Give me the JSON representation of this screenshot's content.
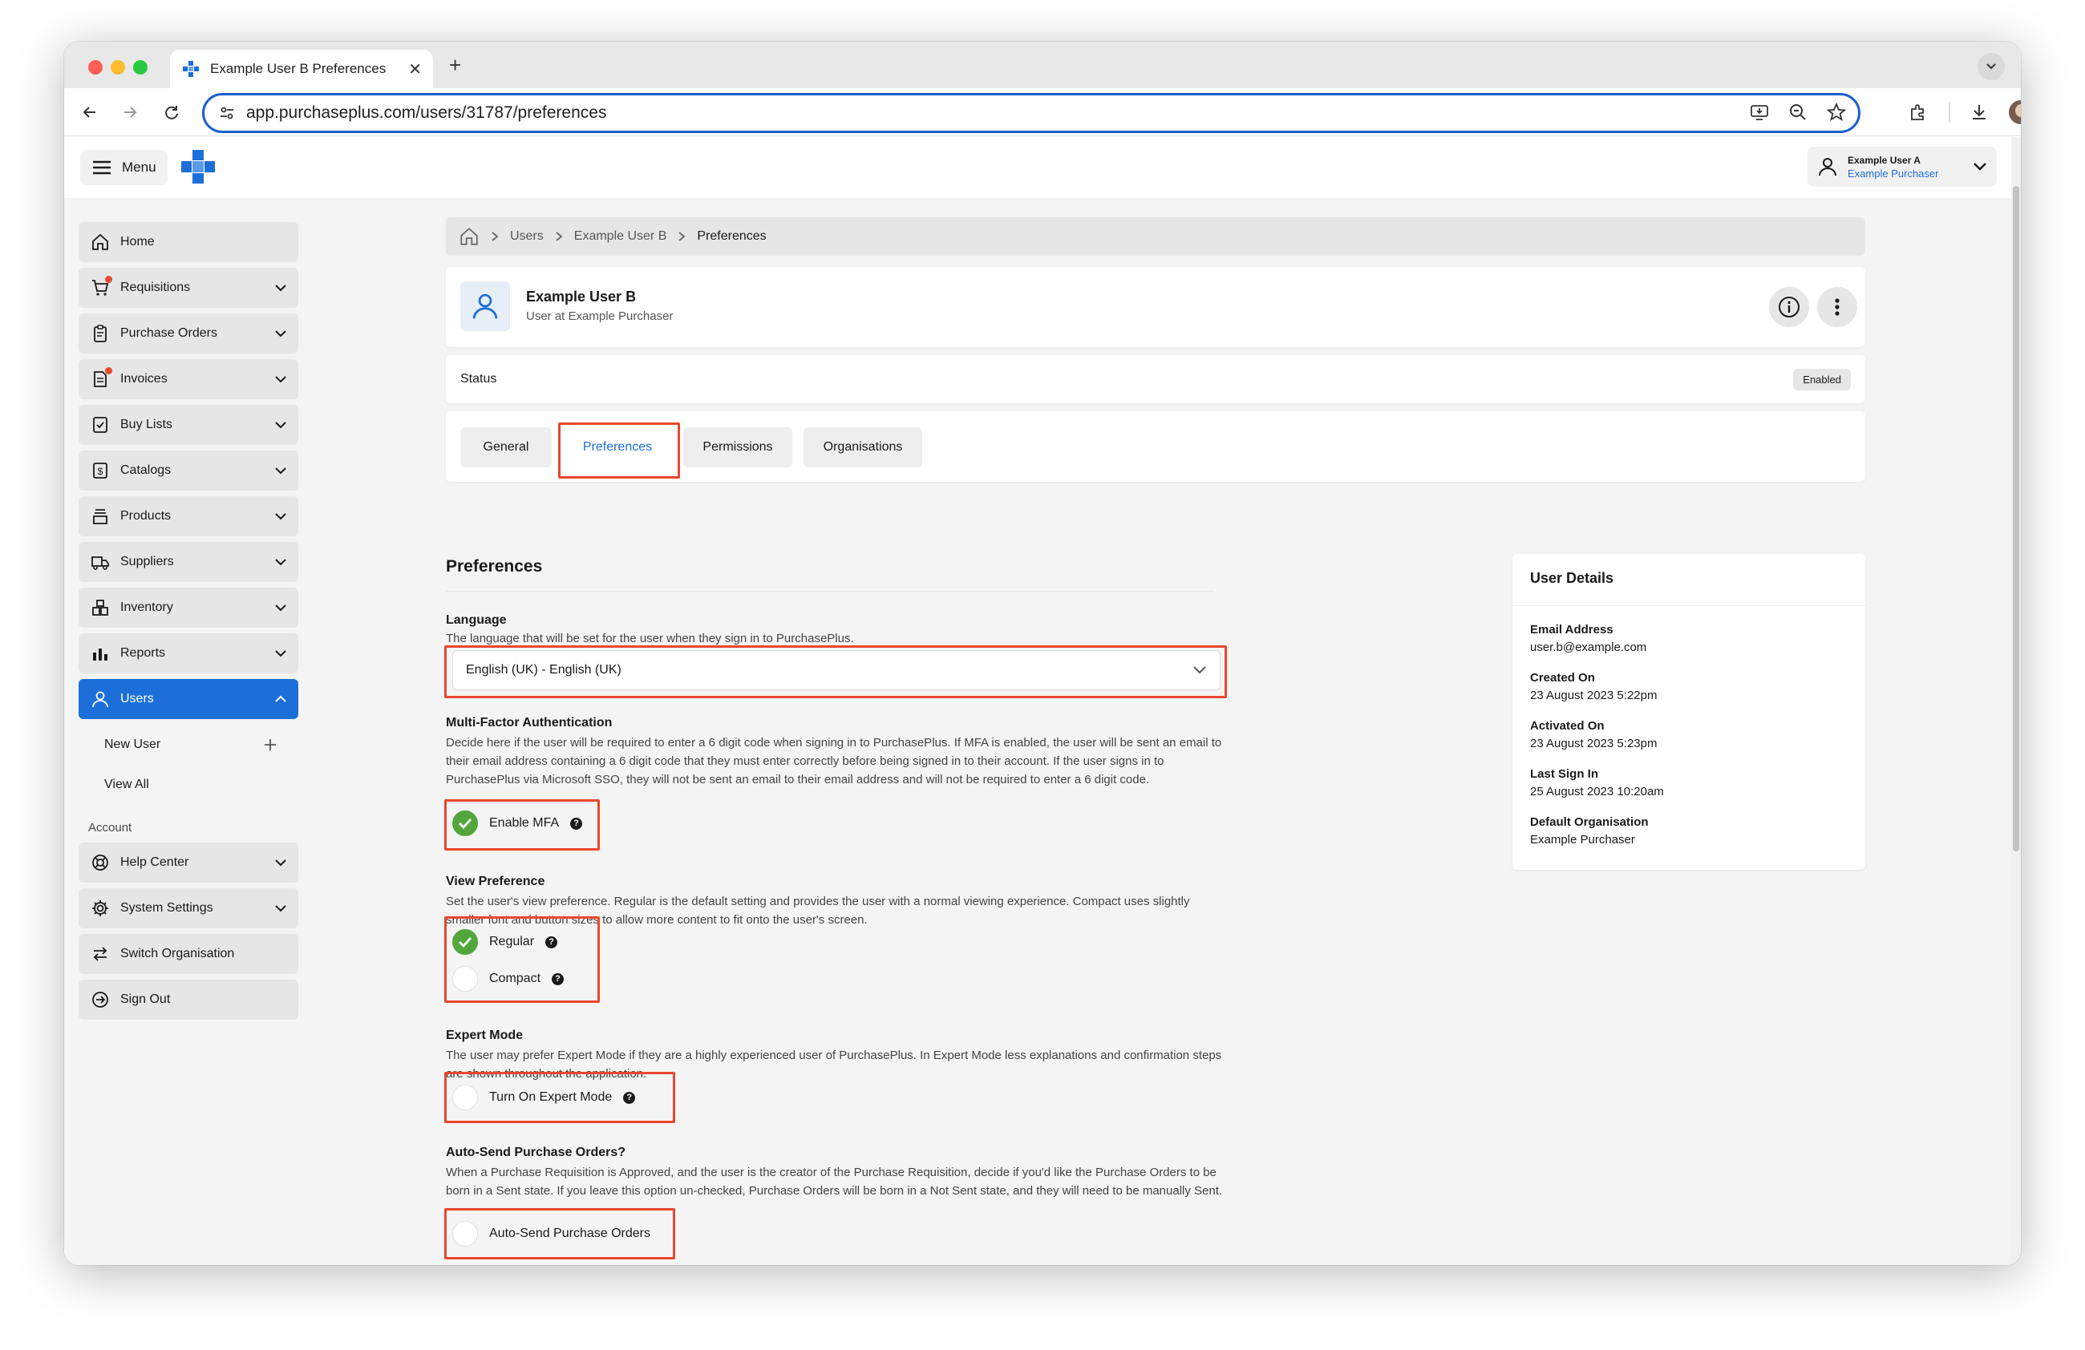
{
  "browser": {
    "tab_title": "Example User B Preferences",
    "url": "app.purchaseplus.com/users/31787/preferences"
  },
  "header": {
    "menu_label": "Menu",
    "user_name": "Example User A",
    "user_org": "Example Purchaser"
  },
  "sidebar": {
    "items": [
      {
        "label": "Home",
        "icon": "home-icon"
      },
      {
        "label": "Requisitions",
        "icon": "cart-icon"
      },
      {
        "label": "Purchase Orders",
        "icon": "clipboard-icon"
      },
      {
        "label": "Invoices",
        "icon": "invoice-icon"
      },
      {
        "label": "Buy Lists",
        "icon": "checklist-icon"
      },
      {
        "label": "Catalogs",
        "icon": "catalog-icon"
      },
      {
        "label": "Products",
        "icon": "products-icon"
      },
      {
        "label": "Suppliers",
        "icon": "truck-icon"
      },
      {
        "label": "Inventory",
        "icon": "inventory-icon"
      },
      {
        "label": "Reports",
        "icon": "chart-icon"
      },
      {
        "label": "Users",
        "icon": "user-icon"
      }
    ],
    "users_sub": [
      {
        "label": "New User"
      },
      {
        "label": "View All"
      }
    ],
    "account_heading": "Account",
    "account_items": [
      {
        "label": "Help Center",
        "icon": "lifebuoy-icon"
      },
      {
        "label": "System Settings",
        "icon": "gear-icon"
      },
      {
        "label": "Switch Organisation",
        "icon": "switch-icon"
      },
      {
        "label": "Sign Out",
        "icon": "sign-out-icon"
      }
    ]
  },
  "breadcrumb": {
    "items": [
      "Users",
      "Example User B",
      "Preferences"
    ]
  },
  "user_card": {
    "name": "Example User B",
    "subtitle": "User at Example Purchaser"
  },
  "status": {
    "label": "Status",
    "value": "Enabled"
  },
  "tabs": [
    {
      "label": "General"
    },
    {
      "label": "Preferences"
    },
    {
      "label": "Permissions"
    },
    {
      "label": "Organisations"
    }
  ],
  "preferences": {
    "title": "Preferences",
    "language": {
      "label": "Language",
      "description": "The language that will be set for the user when they sign in to PurchasePlus.",
      "value": "English (UK) - English (UK)"
    },
    "mfa": {
      "label": "Multi-Factor Authentication",
      "description": "Decide here if the user will be required to enter a 6 digit code when signing in to PurchasePlus. If MFA is enabled, the user will be sent an email to their email address containing a 6 digit code that they must enter correctly before being signed in to their account. If the user signs in to PurchasePlus via Microsoft SSO, they will not be sent an email to their email address and will not be required to enter a 6 digit code.",
      "option": "Enable MFA",
      "checked": true
    },
    "view": {
      "label": "View Preference",
      "description": "Set the user's view preference. Regular is the default setting and provides the user with a normal viewing experience. Compact uses slightly smaller font and button sizes to allow more content to fit onto the user's screen.",
      "option_regular": "Regular",
      "option_compact": "Compact",
      "selected": "Regular"
    },
    "expert": {
      "label": "Expert Mode",
      "description": "The user may prefer Expert Mode if they are a highly experienced user of PurchasePlus. In Expert Mode less explanations and confirmation steps are shown throughout the application.",
      "option": "Turn On Expert Mode",
      "checked": false
    },
    "autosend": {
      "label": "Auto-Send Purchase Orders?",
      "description": "When a Purchase Requisition is Approved, and the user is the creator of the Purchase Requisition, decide if you'd like the Purchase Orders to be born in a Sent state. If you leave this option un-checked, Purchase Orders will be born in a Not Sent state, and they will need to be manually Sent.",
      "option": "Auto-Send Purchase Orders",
      "checked": false
    }
  },
  "user_details": {
    "title": "User Details",
    "fields": [
      {
        "key": "Email Address",
        "value": "user.b@example.com"
      },
      {
        "key": "Created On",
        "value": "23 August 2023 5:22pm"
      },
      {
        "key": "Activated On",
        "value": "23 August 2023 5:23pm"
      },
      {
        "key": "Last Sign In",
        "value": "25 August 2023 10:20am"
      },
      {
        "key": "Default Organisation",
        "value": "Example Purchaser"
      }
    ]
  },
  "colors": {
    "accent": "#1c6fd8",
    "highlight": "#e8472e",
    "check_green": "#52a63b"
  }
}
